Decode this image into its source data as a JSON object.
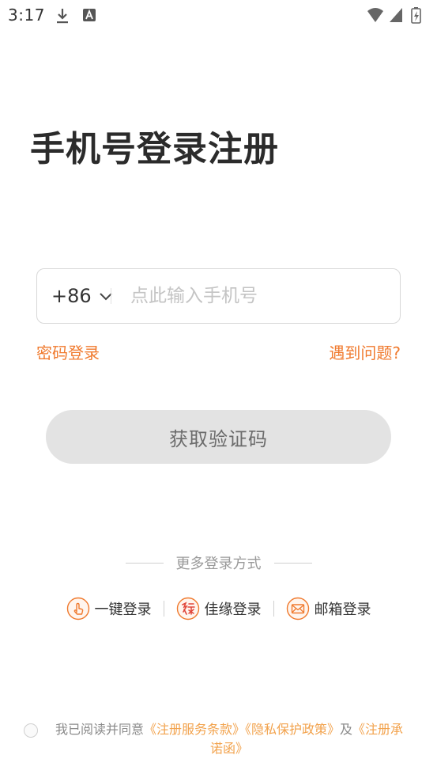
{
  "status_bar": {
    "time": "3:17"
  },
  "title": "手机号登录注册",
  "phone": {
    "country_code": "+86",
    "placeholder": "点此输入手机号",
    "value": ""
  },
  "links": {
    "password_login": "密码登录",
    "help": "遇到问题?"
  },
  "get_code_button": "获取验证码",
  "more_login": {
    "label": "更多登录方式",
    "options": [
      {
        "label": "一键登录",
        "icon": "touch-icon"
      },
      {
        "label": "佳缘登录",
        "icon": "jiayuan-icon"
      },
      {
        "label": "邮箱登录",
        "icon": "mail-icon"
      }
    ]
  },
  "agreement": {
    "prefix": "我已阅读并同意",
    "terms": "《注册服务条款》",
    "privacy": "《隐私保护政策》",
    "and": "及",
    "pledge": "《注册承诺函》"
  },
  "colors": {
    "accent": "#f07a2e",
    "agreement_link": "#f2a24c",
    "button_bg": "#e3e3e3"
  }
}
